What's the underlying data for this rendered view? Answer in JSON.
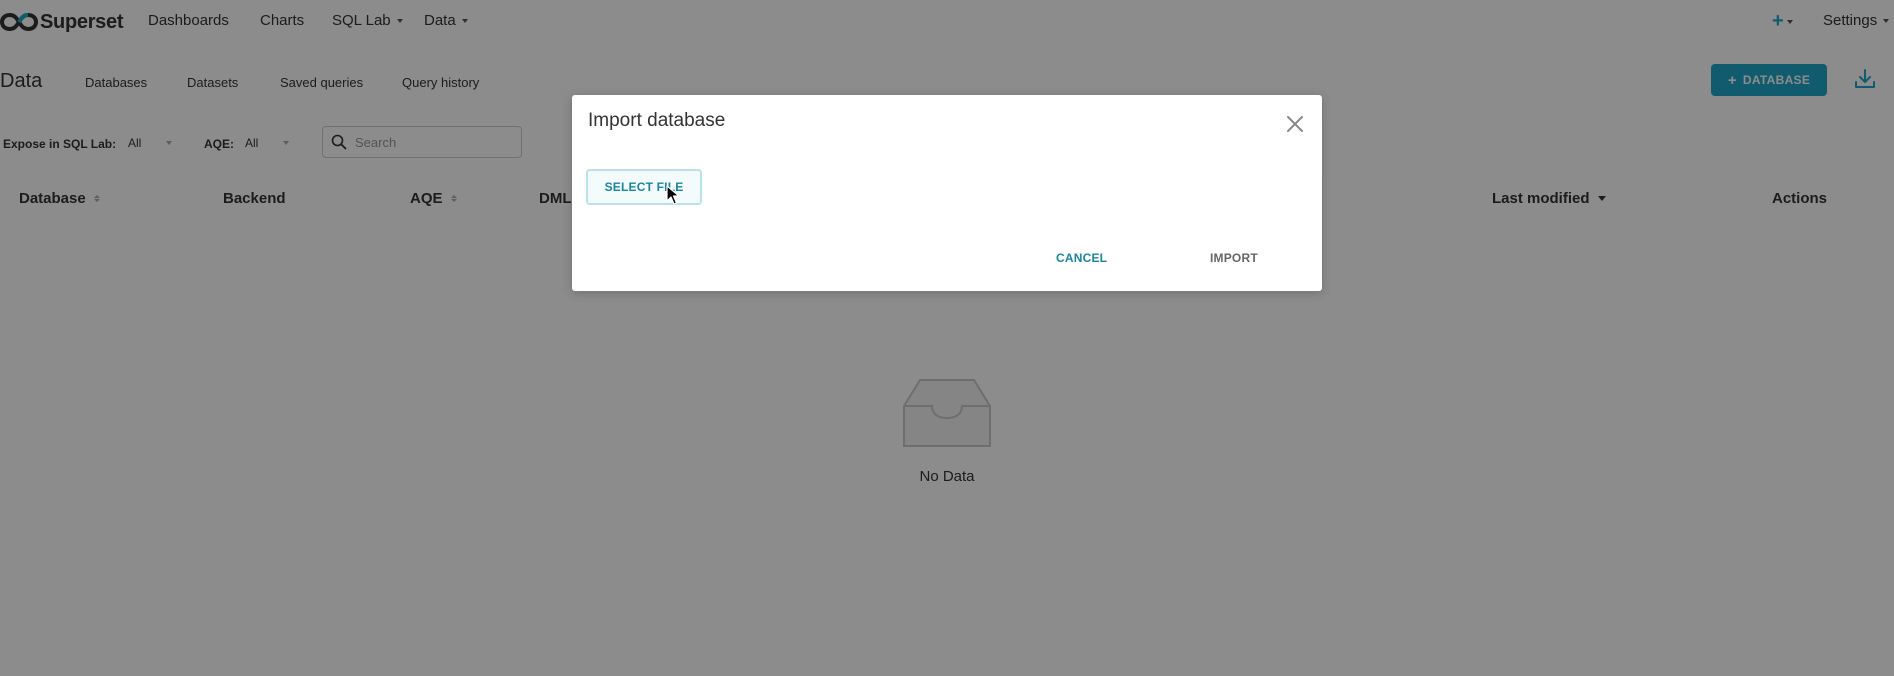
{
  "navbar": {
    "brand": "Superset",
    "items": [
      {
        "label": "Dashboards",
        "has_caret": false
      },
      {
        "label": "Charts",
        "has_caret": false
      },
      {
        "label": "SQL Lab",
        "has_caret": true
      },
      {
        "label": "Data",
        "has_caret": true
      }
    ],
    "plus_label": "+",
    "settings_label": "Settings"
  },
  "subheader": {
    "title": "Data",
    "tabs": [
      "Databases",
      "Datasets",
      "Saved queries",
      "Query history"
    ],
    "add_database_label": "DATABASE",
    "add_database_icon": "+"
  },
  "filters": {
    "expose_label": "Expose in SQL Lab:",
    "expose_value": "All",
    "aqe_label": "AQE:",
    "aqe_value": "All",
    "search_placeholder": "Search"
  },
  "table": {
    "columns": [
      "Database",
      "Backend",
      "AQE",
      "DML",
      "Last modified",
      "Actions"
    ],
    "empty_text": "No Data"
  },
  "modal": {
    "title": "Import database",
    "select_file_label": "SELECT FILE",
    "cancel_label": "CANCEL",
    "import_label": "IMPORT"
  },
  "colors": {
    "accent": "#20a7c9",
    "accent_dark": "#1a85a0",
    "overlay": "rgba(0,0,0,0.45)"
  }
}
